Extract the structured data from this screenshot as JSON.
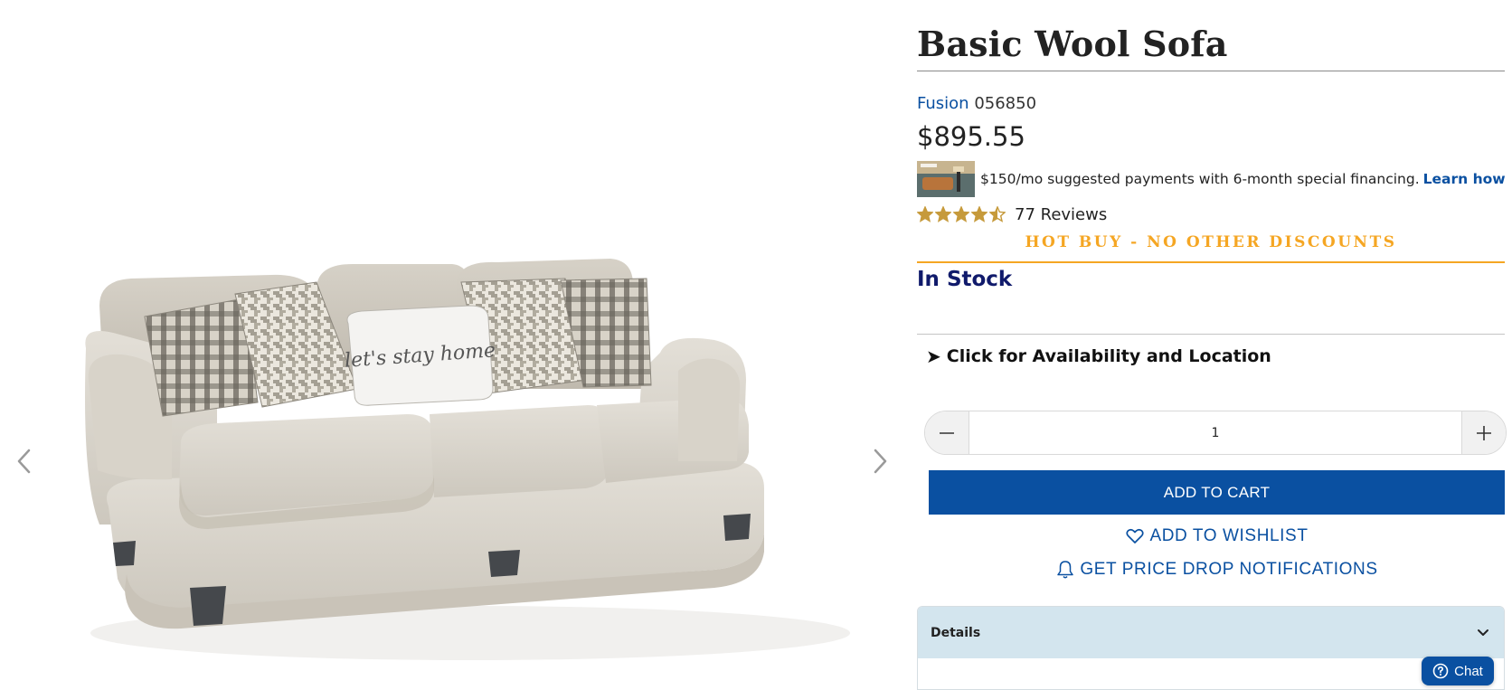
{
  "gallery": {
    "image_alt": "Basic Wool Sofa",
    "pillow_text": "let's stay home",
    "prev_icon": "chevron-left-icon",
    "next_icon": "chevron-right-icon"
  },
  "product": {
    "title": "Basic Wool Sofa",
    "brand": "Fusion",
    "sku": "056850",
    "price": "$895.55",
    "financing_text": "$150/mo suggested payments with 6-month special financing.",
    "financing_link": "Learn how",
    "rating": 4.5,
    "rating_max": 5,
    "reviews_label": "77 Reviews",
    "promo": "HOT BUY - NO OTHER DISCOUNTS",
    "stock_status": "In Stock",
    "availability_label": "Click for Availability and Location",
    "quantity": "1",
    "add_to_cart": "ADD TO CART",
    "wishlist": "ADD TO WISHLIST",
    "price_drop": "GET PRICE DROP NOTIFICATIONS",
    "details_label": "Details"
  },
  "chat": {
    "label": "Chat"
  },
  "colors": {
    "brand_blue": "#0a50a1",
    "stock_navy": "#101a6b",
    "promo_orange": "#f5a623",
    "star_gold": "#c69a3b",
    "details_bg": "#d3e5ee"
  }
}
